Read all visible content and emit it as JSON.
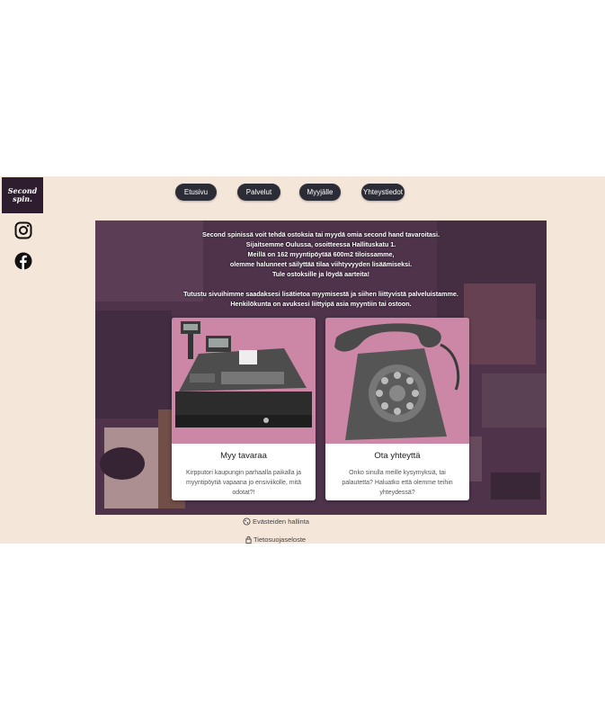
{
  "logo": {
    "line1": "Second",
    "line2": "spin."
  },
  "social": {
    "instagram": "instagram-icon",
    "facebook": "facebook-icon"
  },
  "nav": {
    "items": [
      "Etusivu",
      "Palvelut",
      "Myyjälle",
      "Yhteystiedot"
    ]
  },
  "hero": {
    "lines": [
      "Second spinissä voit tehdä ostoksia tai myydä omia second hand tavaroitasi.",
      "Sijaitsemme Oulussa, osoitteessa Hallituskatu 1.",
      "Meillä on 162 myyntipöytää 600m2 tiloissamme,",
      "olemme halunneet säilyttää tilaa viihtyvyyden lisäämiseksi.",
      "Tule ostoksille ja löydä aarteita!",
      "Tutustu sivuihimme saadaksesi lisätietoa myymisestä ja siihen liittyvistä palveluistamme.",
      "Henkilökunta on avuksesi liittyipä asia myyntiin tai ostoon."
    ]
  },
  "cards": [
    {
      "title": "Myy tavaraa",
      "desc": "Kirpputori kaupungin parhaalla paikalla ja myyntipöytiä vapaana jo ensiviikolle, mitä odotat?!",
      "image": "cash-register-image"
    },
    {
      "title": "Ota yhteyttä",
      "desc": "Onko sinulla meille kysymyksiä, tai palautetta? Haluatko että olemme teihin yhteydessä?",
      "image": "telephone-image"
    }
  ],
  "footer": {
    "cookies": "Evästeiden hallinta",
    "privacy": "Tietosuojaseloste"
  },
  "colors": {
    "background": "#f5e6da",
    "nav_button": "#2b2c36",
    "card_image_bg": "#cc87a6",
    "logo_bg": "#2e1d2f"
  }
}
